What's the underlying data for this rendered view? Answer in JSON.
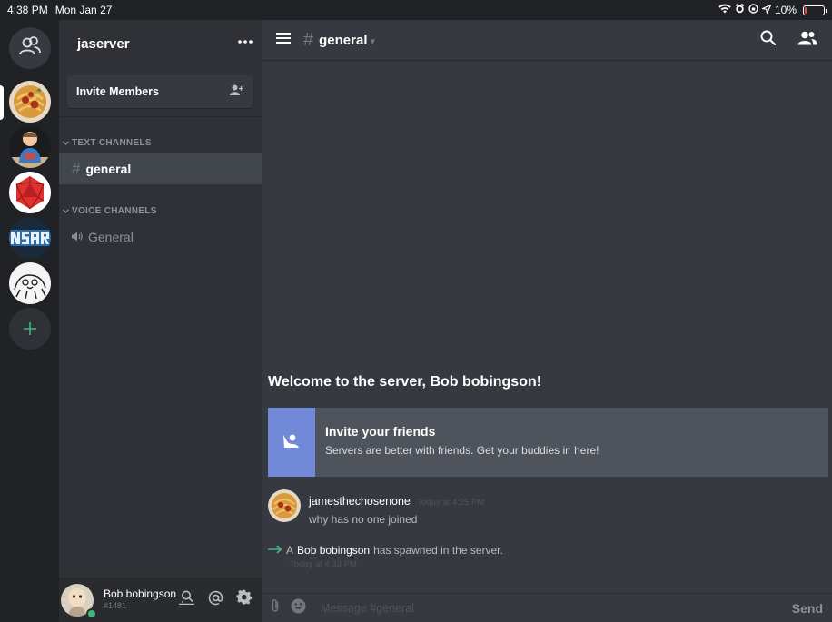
{
  "status_bar": {
    "time": "4:38 PM",
    "date": "Mon Jan 27",
    "battery": "10%",
    "battery_level": 0.1
  },
  "server": {
    "name": "jaserver",
    "invite_members_label": "Invite Members"
  },
  "categories": {
    "text": "TEXT CHANNELS",
    "voice": "VOICE CHANNELS"
  },
  "channels": {
    "text": [
      {
        "name": "general"
      }
    ],
    "voice": [
      {
        "name": "General"
      }
    ]
  },
  "user": {
    "name": "Bob bobingson",
    "tag": "#1481"
  },
  "main": {
    "channel_name": "general",
    "welcome": "Welcome to the server, Bob bobingson!",
    "invite_card": {
      "title": "Invite your friends",
      "subtitle": "Servers are better with friends. Get your buddies in here!"
    },
    "message": {
      "author": "jamesthechosenone",
      "timestamp": "Today at 4:25 PM",
      "text": "why has no one joined"
    },
    "system_message": {
      "prefix": "A",
      "user": "Bob bobingson",
      "suffix": "has spawned in the server.",
      "timestamp": "Today at 4:33 PM"
    },
    "composer": {
      "placeholder": "Message #general",
      "send_label": "Send"
    }
  },
  "colors": {
    "accent": "#7289da",
    "online": "#43b581",
    "background": "#36393f",
    "sidebar": "#2f3136",
    "rail": "#202225"
  }
}
